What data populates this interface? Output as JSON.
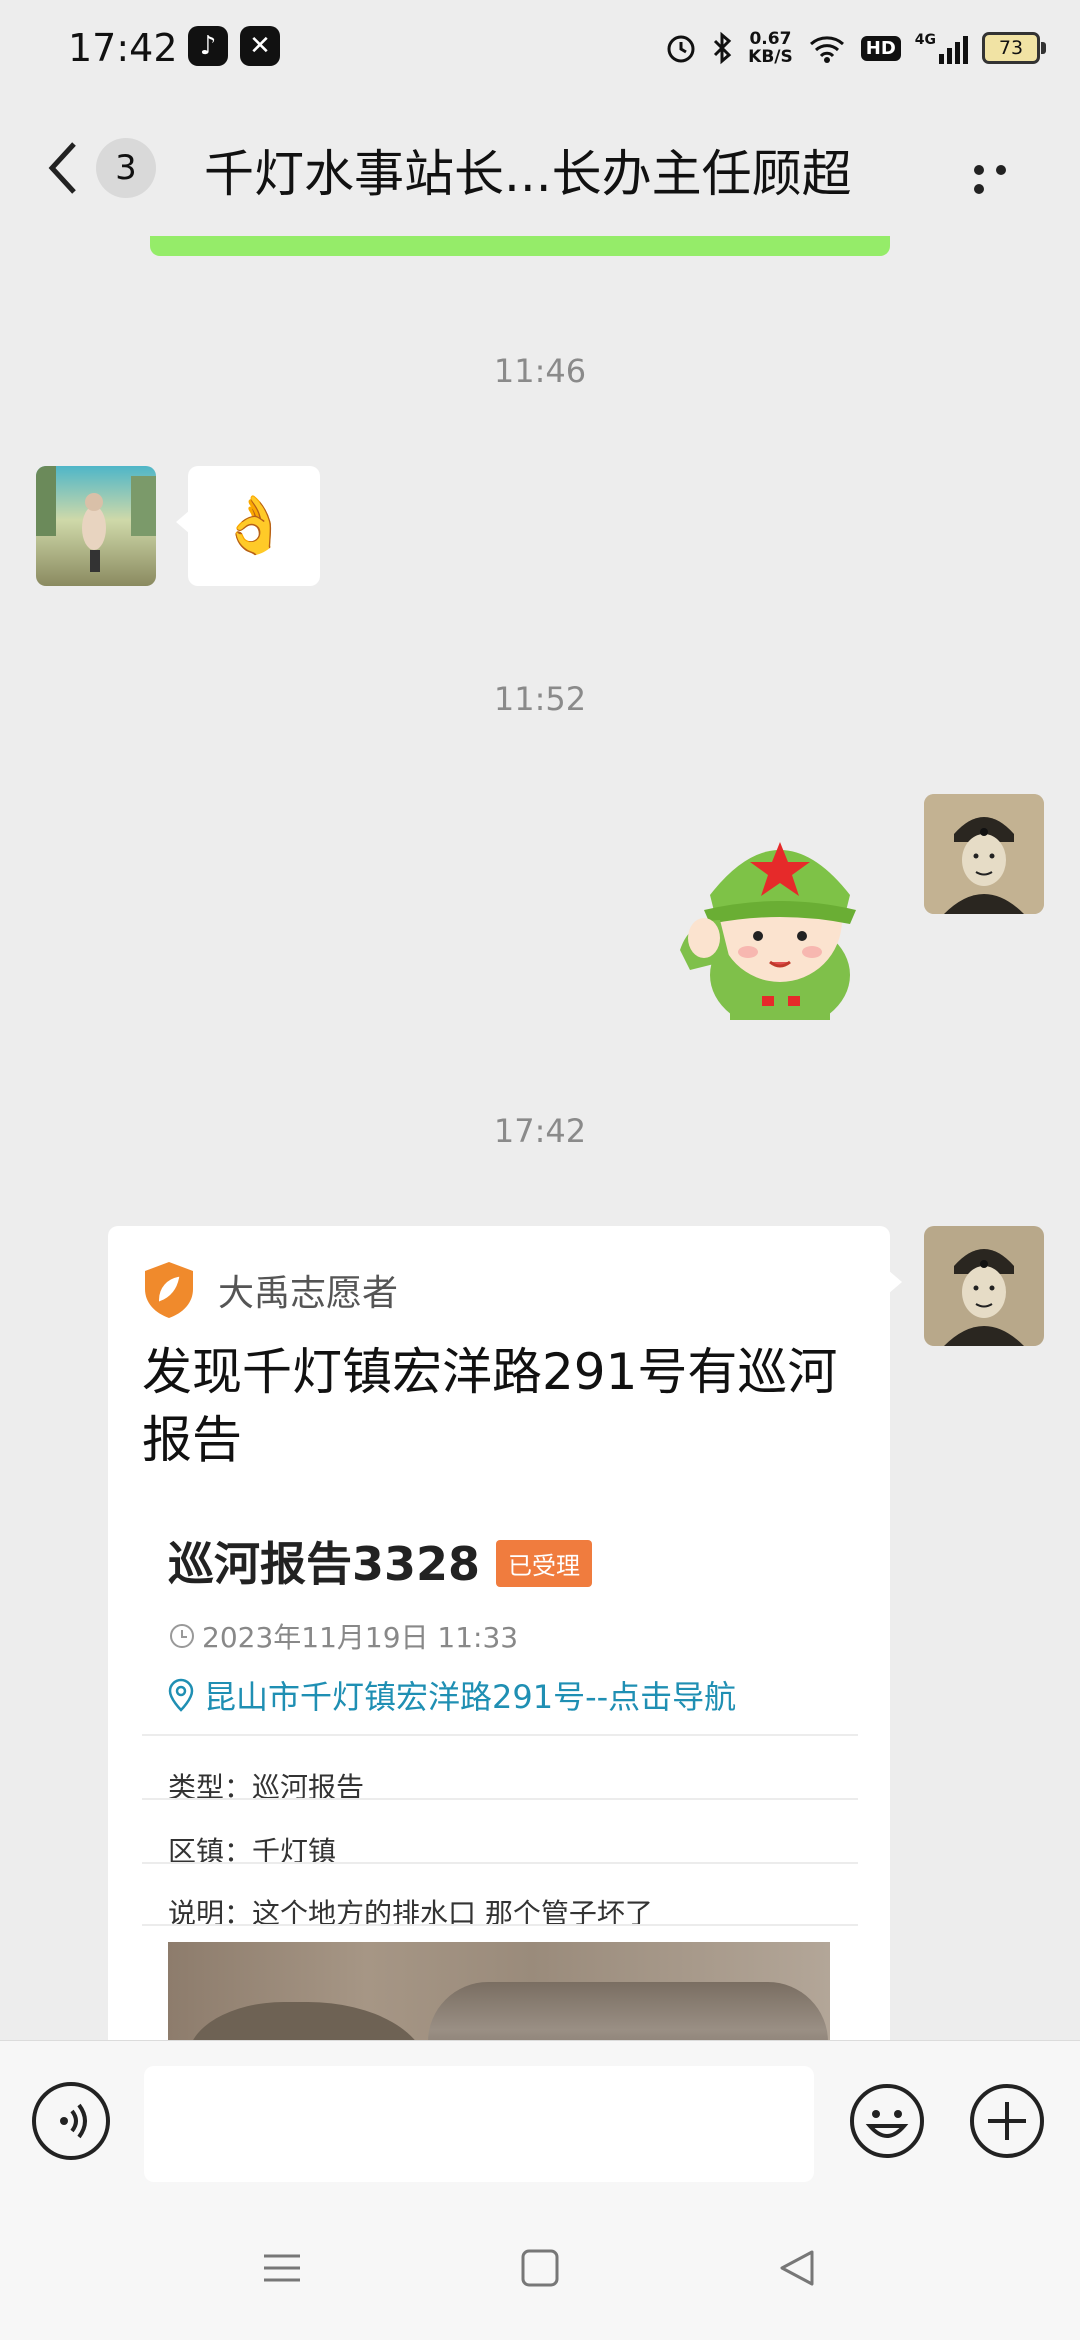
{
  "status_bar": {
    "time": "17:42",
    "network_speed_value": "0.67",
    "network_speed_unit": "KB/S",
    "hd_label": "HD",
    "signal_label": "4G",
    "battery": "73"
  },
  "nav": {
    "unread_count": "3",
    "title": "千灯水事站长...长办主任顾超"
  },
  "messages": {
    "time_1": "11:46",
    "time_2": "11:52",
    "time_3": "17:42",
    "emoji_message": "👌"
  },
  "card": {
    "source_name": "大禹志愿者",
    "title": "发现千灯镇宏洋路291号有巡河报告",
    "report_title": "巡河报告3328",
    "status_tag": "已受理",
    "datetime": "2023年11月19日 11:33",
    "location": "昆山市千灯镇宏洋路291号--点击导航",
    "type_label": "类型：",
    "type_value": "巡河报告",
    "town_label": "区镇：",
    "town_value": "千灯镇",
    "desc_label": "说明：",
    "desc_value": "这个地方的排水口 那个管子坏了"
  },
  "input_bar": {
    "placeholder": ""
  },
  "colors": {
    "accent_green": "#95ec69",
    "tag_orange": "#f07c3e",
    "link_blue": "#1f8fb3"
  }
}
